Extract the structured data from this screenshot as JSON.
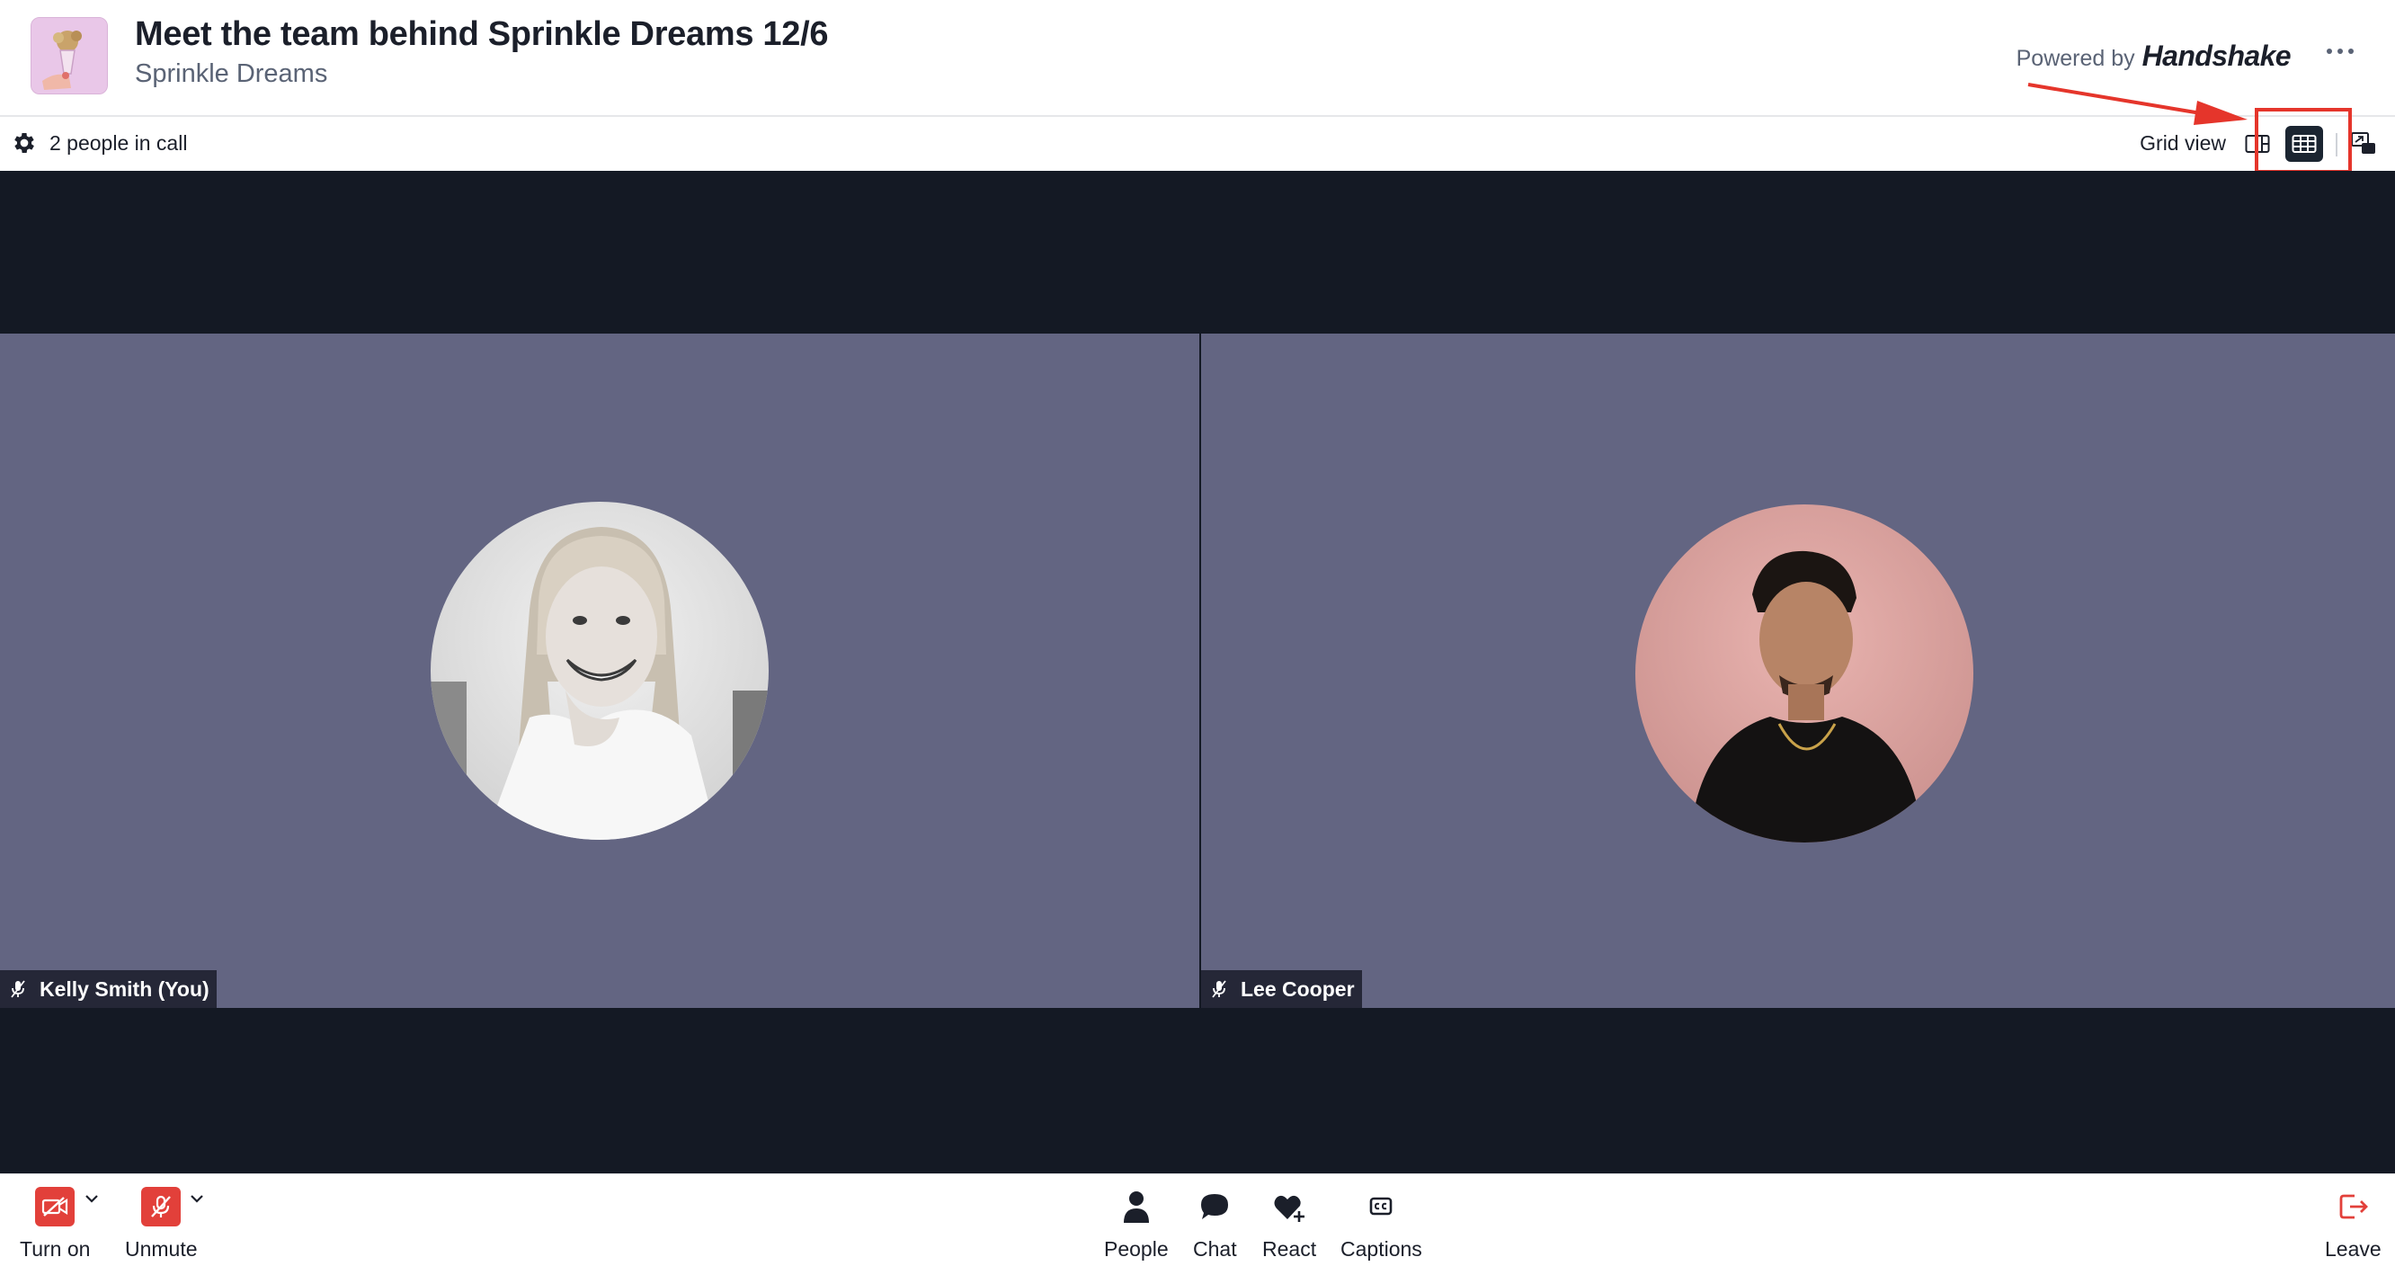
{
  "header": {
    "title": "Meet the team behind Sprinkle Dreams 12/6",
    "subtitle": "Sprinkle Dreams",
    "powered_by_prefix": "Powered by",
    "powered_by_brand": "Handshake"
  },
  "toolbar": {
    "people_count": "2 people in call",
    "view_label": "Grid view",
    "active_view": "grid"
  },
  "participants": [
    {
      "name": "Kelly Smith (You)",
      "muted": true
    },
    {
      "name": "Lee Cooper",
      "muted": true
    }
  ],
  "controls": {
    "camera_label": "Turn on",
    "mic_label": "Unmute",
    "people_label": "People",
    "chat_label": "Chat",
    "react_label": "React",
    "captions_label": "Captions",
    "leave_label": "Leave"
  },
  "colors": {
    "accent_red": "#e2403a",
    "tile_bg": "#636582",
    "stage_bg": "#141924",
    "annotation": "#e5352b"
  }
}
